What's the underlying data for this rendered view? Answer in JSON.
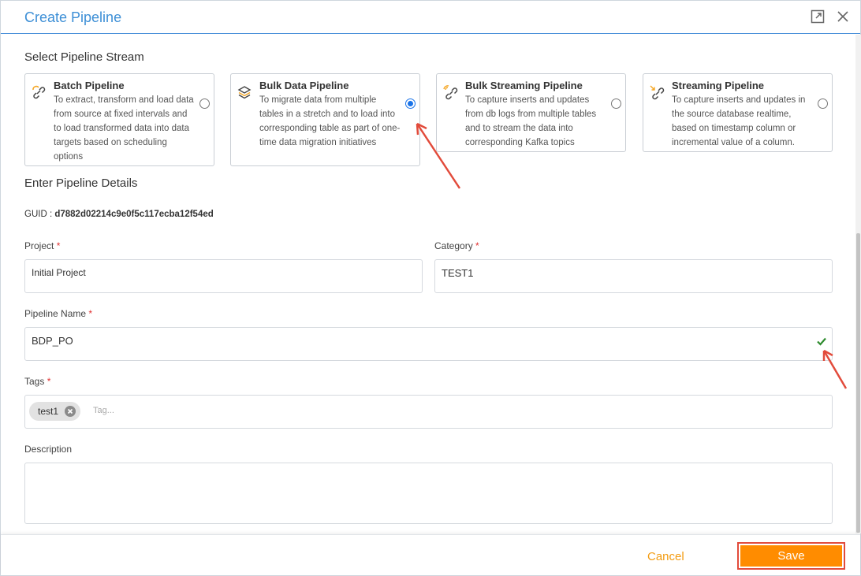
{
  "dialog": {
    "title": "Create Pipeline"
  },
  "stream_section": {
    "title": "Select Pipeline Stream",
    "cards": [
      {
        "title": "Batch Pipeline",
        "description": "To extract, transform and load data from source at fixed intervals and to load transformed data into data targets based on scheduling options",
        "selected": false,
        "icon": "batch-link-icon"
      },
      {
        "title": "Bulk Data Pipeline",
        "description": "To migrate data from multiple tables in a stretch and to load into corresponding table as part of one-time data migration initiatives",
        "selected": true,
        "icon": "layers-icon"
      },
      {
        "title": "Bulk Streaming Pipeline",
        "description": "To capture inserts and updates from db logs from multiple tables and to stream the data into corresponding Kafka topics",
        "selected": false,
        "icon": "streaming-link-icon"
      },
      {
        "title": "Streaming Pipeline",
        "description": "To capture inserts and updates in the source database realtime, based on timestamp column or incremental value of a column.",
        "selected": false,
        "icon": "arrow-link-icon"
      }
    ]
  },
  "details_section": {
    "title": "Enter Pipeline Details",
    "guid_label": "GUID :",
    "guid_value": "d7882d02214c9e0f5c117ecba12f54ed",
    "required_mark": "*",
    "project": {
      "label": "Project",
      "value": "Initial Project"
    },
    "category": {
      "label": "Category",
      "value": "TEST1"
    },
    "pipeline_name": {
      "label": "Pipeline Name",
      "value": "BDP_PO",
      "valid": true
    },
    "tags": {
      "label": "Tags",
      "items": [
        "test1"
      ],
      "placeholder": "Tag..."
    },
    "description": {
      "label": "Description",
      "value": ""
    }
  },
  "footer": {
    "cancel_label": "Cancel",
    "save_label": "Save"
  },
  "colors": {
    "title_blue": "#3d8fd6",
    "accent_orange": "#ff8c00",
    "cancel_orange": "#f39c12",
    "annotation_red": "#e24b3b",
    "radio_blue": "#1a73e8",
    "valid_green": "#2e8b2e"
  }
}
